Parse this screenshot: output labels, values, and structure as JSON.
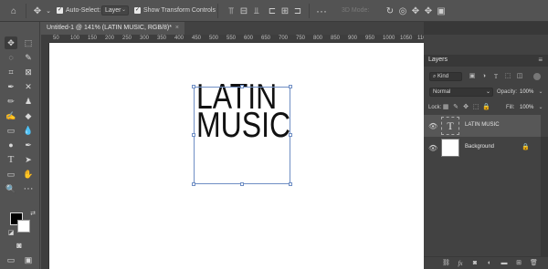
{
  "options_bar": {
    "auto_select_label": "Auto-Select:",
    "auto_select_value": "Layer",
    "transform_label": "Show Transform Controls",
    "mode_3d_label": "3D Mode:"
  },
  "document": {
    "tab_title": "Untitled-1 @ 141% (LATIN MUSIC, RGB/8)",
    "tab_modified": "*",
    "canvas_text_line1": "LATIN",
    "canvas_text_line2": "MUSIC",
    "ruler_marks": [
      "50",
      "100",
      "150",
      "200",
      "250",
      "300",
      "350",
      "400",
      "450",
      "500",
      "550",
      "600",
      "650",
      "700",
      "750",
      "800",
      "850",
      "900",
      "950",
      "1000",
      "1050",
      "1100"
    ]
  },
  "layers_panel": {
    "title": "Layers",
    "filter_label": "Kind",
    "blend_mode": "Normal",
    "opacity_label": "Opacity:",
    "opacity_value": "100%",
    "lock_label": "Lock:",
    "fill_label": "Fill:",
    "fill_value": "100%",
    "layers": [
      {
        "name": "LATIN MUSIC",
        "type": "text",
        "thumb_glyph": "T",
        "selected": true
      },
      {
        "name": "Background",
        "type": "background",
        "locked": true,
        "selected": false
      }
    ]
  },
  "colors": {
    "foreground": "#000000",
    "background": "#ffffff",
    "selection_outline": "#6f8ec4"
  }
}
